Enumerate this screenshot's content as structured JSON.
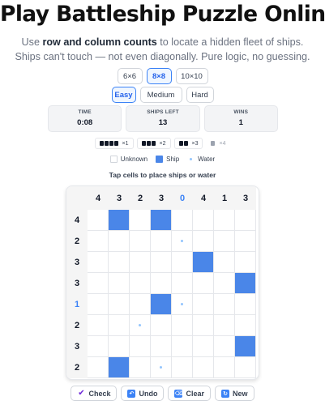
{
  "title": "Play Battleship Puzzle Online",
  "subtitle": {
    "pre": "Use ",
    "bold": "row and column counts",
    "post": " to locate a hidden fleet of ships. Ships can't touch — not even diagonally. Pure logic, no guessing."
  },
  "sizes": [
    "6×6",
    "8×8",
    "10×10"
  ],
  "selected_size": "8×8",
  "difficulties": [
    "Easy",
    "Medium",
    "Hard"
  ],
  "selected_difficulty": "Easy",
  "stats": {
    "time_label": "TIME",
    "time_value": "0:08",
    "ships_label": "SHIPS LEFT",
    "ships_value": "13",
    "wins_label": "WINS",
    "wins_value": "1"
  },
  "fleet": [
    {
      "length": 4,
      "count": "×1",
      "done": false
    },
    {
      "length": 3,
      "count": "×2",
      "done": false
    },
    {
      "length": 2,
      "count": "×3",
      "done": false
    },
    {
      "length": 1,
      "count": "×4",
      "done": true
    }
  ],
  "legend": {
    "unknown": "Unknown",
    "ship": "Ship",
    "water": "Water"
  },
  "hint": "Tap cells to place ships or water",
  "board": {
    "col_clues": [
      "4",
      "3",
      "2",
      "3",
      "0",
      "4",
      "1",
      "3"
    ],
    "col_done": [
      false,
      false,
      false,
      false,
      true,
      false,
      false,
      false
    ],
    "row_clues": [
      "4",
      "2",
      "3",
      "3",
      "1",
      "2",
      "3",
      "2"
    ],
    "row_done": [
      false,
      false,
      false,
      false,
      true,
      false,
      false,
      false
    ],
    "cells": [
      [
        "",
        "S",
        "",
        "S",
        "",
        "",
        "",
        ""
      ],
      [
        "",
        "",
        "",
        "",
        "W",
        "",
        "",
        ""
      ],
      [
        "",
        "",
        "",
        "",
        "",
        "S",
        "",
        ""
      ],
      [
        "",
        "",
        "",
        "",
        "",
        "",
        "",
        "S"
      ],
      [
        "",
        "",
        "",
        "S",
        "W",
        "",
        "",
        ""
      ],
      [
        "",
        "",
        "W",
        "",
        "",
        "",
        "",
        ""
      ],
      [
        "",
        "",
        "",
        "",
        "",
        "",
        "",
        "S"
      ],
      [
        "",
        "S",
        "",
        "W",
        "",
        "",
        "",
        ""
      ]
    ]
  },
  "actions": {
    "check": "Check",
    "check_icon": "check-icon",
    "undo": "Undo",
    "undo_icon": "undo-icon",
    "clear": "Clear",
    "clear_icon": "clear-icon",
    "new": "New",
    "new_icon": "new-icon"
  },
  "colors": {
    "ship": "#4a86e8",
    "accent": "#3b82f6",
    "water_dot": "#93c5fd"
  }
}
